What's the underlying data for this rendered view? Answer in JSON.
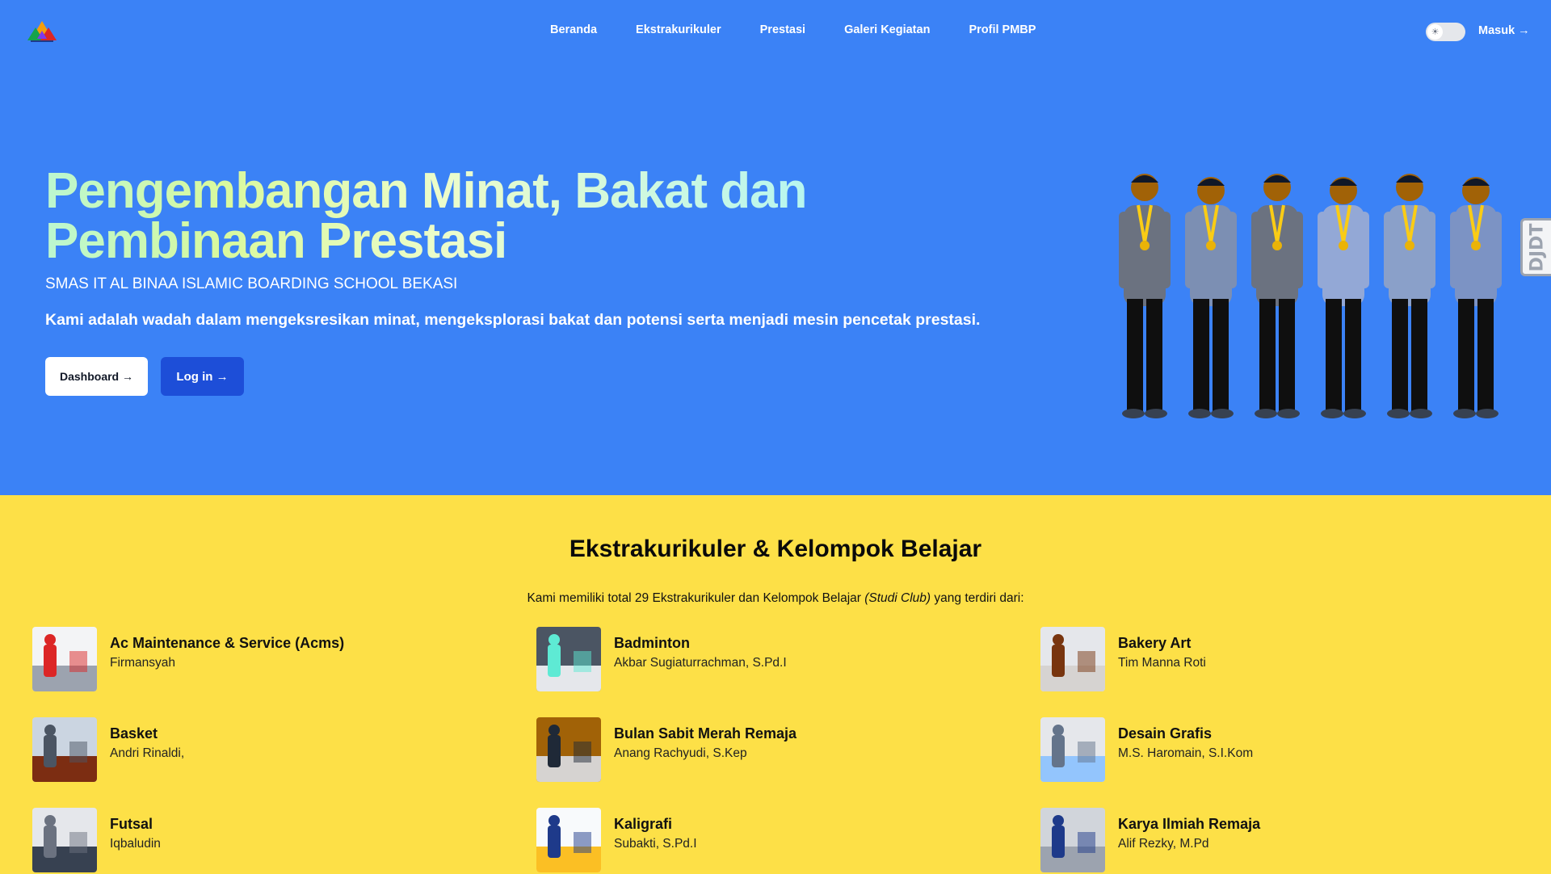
{
  "nav": {
    "links": [
      "Beranda",
      "Ekstrakurikuler",
      "Prestasi",
      "Galeri Kegiatan",
      "Profil PMBP"
    ],
    "login_label": "Masuk →",
    "theme_toggle_icon": "sun-icon"
  },
  "hero": {
    "title": "Pengembangan Minat, Bakat dan Pembinaan Prestasi",
    "subtitle": "SMAS IT AL BINAA ISLAMIC BOARDING SCHOOL BEKASI",
    "description": "Kami adalah wadah dalam mengeksresikan minat, mengeksplorasi bakat dan potensi serta menjadi mesin pencetak prestasi.",
    "dashboard_button": "Dashboard →",
    "login_button": "Log in →"
  },
  "side_badge": "DJDT",
  "section": {
    "title": "Ekstrakurikuler & Kelompok Belajar",
    "intro_prefix": "Kami memiliki total 29 Ekstrakurikuler dan Kelompok Belajar ",
    "intro_italic": "(Studi Club)",
    "intro_suffix": " yang terdiri dari:"
  },
  "activities": [
    {
      "name": "Ac Maintenance & Service (Acms)",
      "mentor": "Firmansyah"
    },
    {
      "name": "Badminton",
      "mentor": "Akbar Sugiaturrachman, S.Pd.I"
    },
    {
      "name": "Bakery Art",
      "mentor": "Tim Manna Roti"
    },
    {
      "name": "Basket",
      "mentor": "Andri Rinaldi,"
    },
    {
      "name": "Bulan Sabit Merah Remaja",
      "mentor": "Anang Rachyudi, S.Kep"
    },
    {
      "name": "Desain Grafis",
      "mentor": "M.S. Haromain, S.I.Kom"
    },
    {
      "name": "Futsal",
      "mentor": "Iqbaludin"
    },
    {
      "name": "Kaligrafi",
      "mentor": "Subakti, S.Pd.I"
    },
    {
      "name": "Karya Ilmiah Remaja",
      "mentor": "Alif Rezky, M.Pd"
    }
  ],
  "colors": {
    "hero_bg": "#3b82f6",
    "section_bg": "#fde047",
    "login_button_bg": "#1d4ed8"
  }
}
